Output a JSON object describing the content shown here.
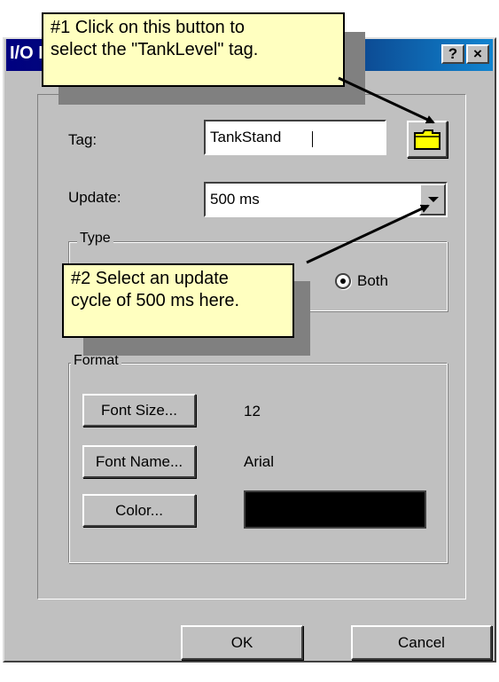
{
  "window": {
    "title": "I/O Field Properties",
    "help_label": "?",
    "close_label": "×"
  },
  "tag": {
    "label": "Tag:",
    "value": "TankStand",
    "browse_icon": "folder-icon"
  },
  "update": {
    "label": "Update:",
    "value": "500 ms"
  },
  "type": {
    "legend": "Type",
    "options": [
      {
        "label": "Both",
        "selected": true
      }
    ]
  },
  "format": {
    "legend": "Format",
    "font_size_button": "Font Size...",
    "font_size_value": "12",
    "font_name_button": "Font Name...",
    "font_name_value": "Arial",
    "color_button": "Color...",
    "color_value": "#000000"
  },
  "buttons": {
    "ok": "OK",
    "cancel": "Cancel"
  },
  "callouts": {
    "first_line1": "#1 Click on this button to",
    "first_line2": "select the \"TankLevel\" tag.",
    "second_line1": "#2 Select an update",
    "second_line2": "cycle of 500 ms here."
  },
  "colors": {
    "dialog_bg": "#c0c0c0",
    "titlebar": "#000080",
    "callout_bg": "#ffffc0",
    "folder": "#ffff00"
  }
}
